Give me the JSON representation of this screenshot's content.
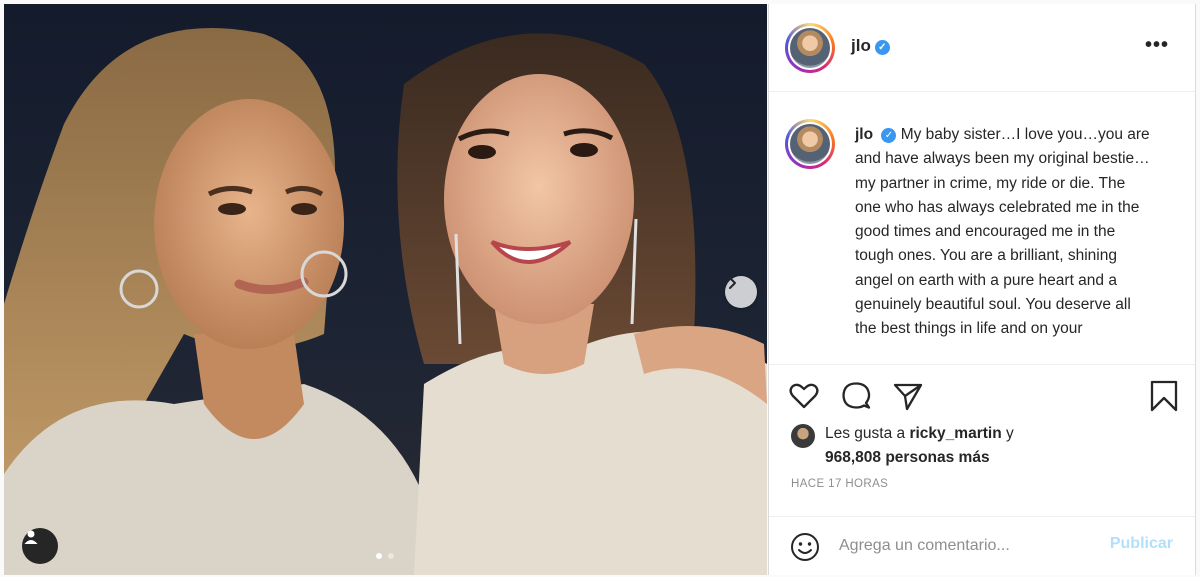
{
  "post": {
    "username": "jlo",
    "verified_mark": "✓",
    "more_label": "•••",
    "caption_user": "jlo",
    "caption_text": "My baby sister…I love you…you are and have always been my original bestie…my partner in crime, my ride or die. The one who has always celebrated me in the good times and encouraged me in the tough ones. You are a brilliant, shining angel on earth with a pure heart and a genuinely beautiful soul. You deserve all the best things in life and on your",
    "likes_prefix": "Les gusta a",
    "likes_user": "ricky_martin",
    "likes_conj": "y",
    "likes_count": "968,808 personas más",
    "time_ago": "HACE 17 HORAS"
  },
  "comment": {
    "placeholder": "Agrega un comentario...",
    "post_label": "Publicar"
  },
  "carousel": {
    "slides": 2,
    "active_index": 0
  },
  "icons": {
    "header_avatar": "profile-avatar",
    "like": "heart-icon",
    "comment": "comment-icon",
    "share": "share-icon",
    "save": "bookmark-icon",
    "emoji": "emoji-icon",
    "tag": "user-tag-icon",
    "next": "chevron-right-icon"
  },
  "colors": {
    "link_blue": "#3897f0",
    "post_disabled": "#b2dffc",
    "muted": "#8e8e8e"
  }
}
